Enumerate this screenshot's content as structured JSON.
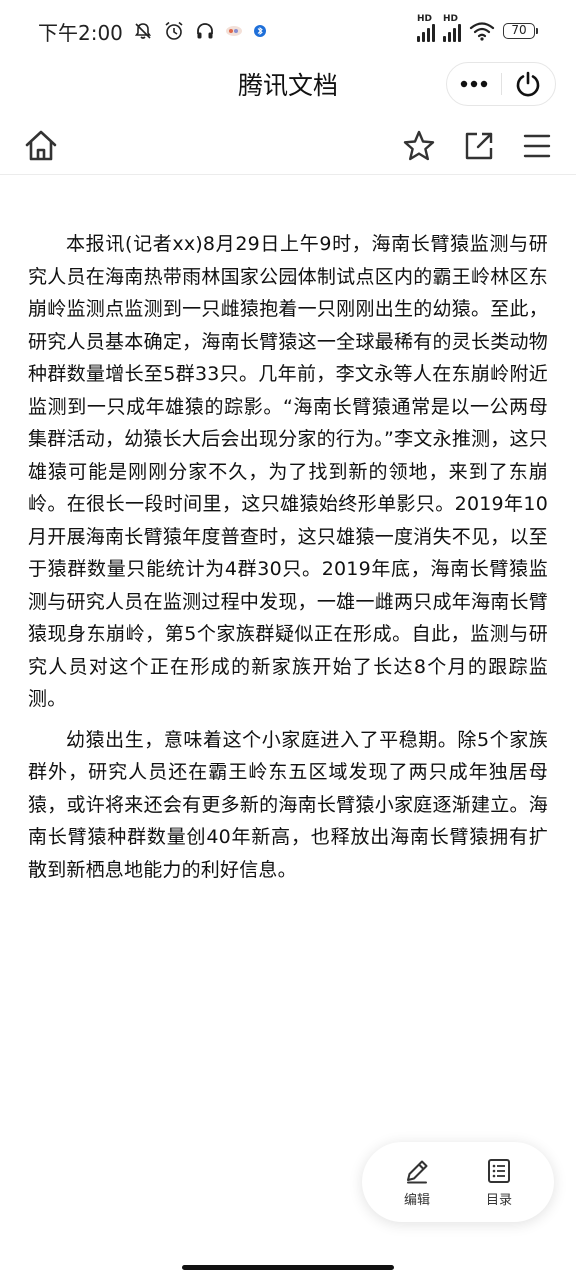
{
  "status_bar": {
    "time": "下午2:00",
    "battery": "70",
    "hd_label": "HD",
    "icons": [
      "bell-off-icon",
      "alarm-icon",
      "headphones-icon",
      "app-notification-icon",
      "bluetooth-dot-icon",
      "signal-icon",
      "wifi-icon",
      "battery-icon"
    ]
  },
  "title_bar": {
    "title": "腾讯文档",
    "icons": [
      "more-icon",
      "power-icon"
    ]
  },
  "toolbar": {
    "icons": [
      "home-icon",
      "star-icon",
      "share-icon",
      "menu-icon"
    ]
  },
  "article": {
    "paragraphs": [
      "本报讯(记者xx)8月29日上午9时，海南长臂猿监测与研究人员在海南热带雨林国家公园体制试点区内的霸王岭林区东崩岭监测点监测到一只雌猿抱着一只刚刚出生的幼猿。至此，研究人员基本确定，海南长臂猿这一全球最稀有的灵长类动物种群数量增长至5群33只。几年前，李文永等人在东崩岭附近监测到一只成年雄猿的踪影。“海南长臂猿通常是以一公两母集群活动，幼猿长大后会出现分家的行为。”李文永推测，这只雄猿可能是刚刚分家不久，为了找到新的领地，来到了东崩岭。在很长一段时间里，这只雄猿始终形单影只。2019年10月开展海南长臂猿年度普查时，这只雄猿一度消失不见，以至于猿群数量只能统计为4群30只。2019年底，海南长臂猿监测与研究人员在监测过程中发现，一雄一雌两只成年海南长臂猿现身东崩岭，第5个家族群疑似正在形成。自此，监测与研究人员对这个正在形成的新家族开始了长达8个月的跟踪监测。",
      "幼猿出生，意味着这个小家庭进入了平稳期。除5个家族群外，研究人员还在霸王岭东五区域发现了两只成年独居母猿，或许将来还会有更多新的海南长臂猿小家庭逐渐建立。海南长臂猿种群数量创40年新高，也释放出海南长臂猿拥有扩散到新栖息地能力的利好信息。"
    ]
  },
  "fab": {
    "edit_label": "编辑",
    "toc_label": "目录",
    "icons": [
      "pencil-icon",
      "list-icon"
    ]
  }
}
